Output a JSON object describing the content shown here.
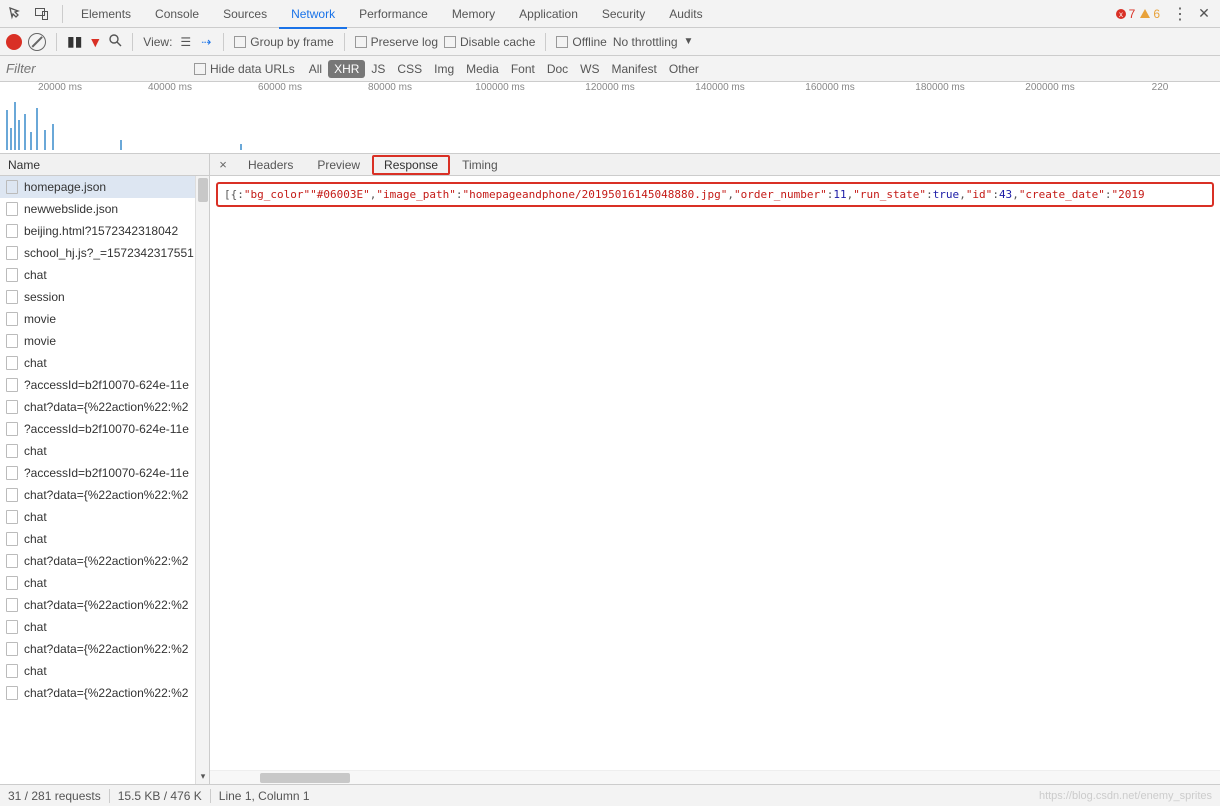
{
  "topTabs": {
    "items": [
      "Elements",
      "Console",
      "Sources",
      "Network",
      "Performance",
      "Memory",
      "Application",
      "Security",
      "Audits"
    ],
    "activeIndex": 3,
    "errors": "7",
    "warnings": "6"
  },
  "toolbar": {
    "viewLabel": "View:",
    "groupByFrame": "Group by frame",
    "preserveLog": "Preserve log",
    "disableCache": "Disable cache",
    "offline": "Offline",
    "throttling": "No throttling"
  },
  "filterRow": {
    "placeholder": "Filter",
    "hideDataUrls": "Hide data URLs",
    "chips": [
      "All",
      "XHR",
      "JS",
      "CSS",
      "Img",
      "Media",
      "Font",
      "Doc",
      "WS",
      "Manifest",
      "Other"
    ],
    "activeChip": 1
  },
  "timeline": {
    "ticks": [
      "20000 ms",
      "40000 ms",
      "60000 ms",
      "80000 ms",
      "100000 ms",
      "120000 ms",
      "140000 ms",
      "160000 ms",
      "180000 ms",
      "200000 ms",
      "220"
    ]
  },
  "sidebar": {
    "header": "Name",
    "selectedIndex": 0,
    "items": [
      "homepage.json",
      "newwebslide.json",
      "beijing.html?1572342318042",
      "school_hj.js?_=1572342317551",
      "chat",
      "session",
      "movie",
      "movie",
      "chat",
      "?accessId=b2f10070-624e-11e",
      "chat?data={%22action%22:%2",
      "?accessId=b2f10070-624e-11e",
      "chat",
      "?accessId=b2f10070-624e-11e",
      "chat?data={%22action%22:%2",
      "chat",
      "chat",
      "chat?data={%22action%22:%2",
      "chat",
      "chat?data={%22action%22:%2",
      "chat",
      "chat?data={%22action%22:%2",
      "chat",
      "chat?data={%22action%22:%2"
    ]
  },
  "detail": {
    "tabs": [
      "Headers",
      "Preview",
      "Response",
      "Timing"
    ],
    "activeIndex": 2,
    "response": {
      "prefix": "[{",
      "parts": [
        {
          "k": "\"bg_color\"",
          "p": ":",
          "v": "\"#06003E\""
        },
        {
          "p": ",",
          "k": "\"image_path\"",
          "p2": ":",
          "v": "\"homepageandphone/20195016145048880.jpg\""
        },
        {
          "p": ",",
          "k": "\"order_number\"",
          "p2": ":",
          "n": "11"
        },
        {
          "p": ",",
          "k": "\"run_state\"",
          "p2": ":",
          "n": "true"
        },
        {
          "p": ",",
          "k": "\"id\"",
          "p2": ":",
          "n": "43"
        },
        {
          "p": ",",
          "k": "\"create_date\"",
          "p2": ":",
          "v": "\"2019"
        }
      ]
    }
  },
  "status": {
    "requests": "31 / 281 requests",
    "transfer": "15.5 KB / 476 K",
    "cursor": "Line 1, Column 1"
  },
  "watermark": "https://blog.csdn.net/enemy_sprites"
}
